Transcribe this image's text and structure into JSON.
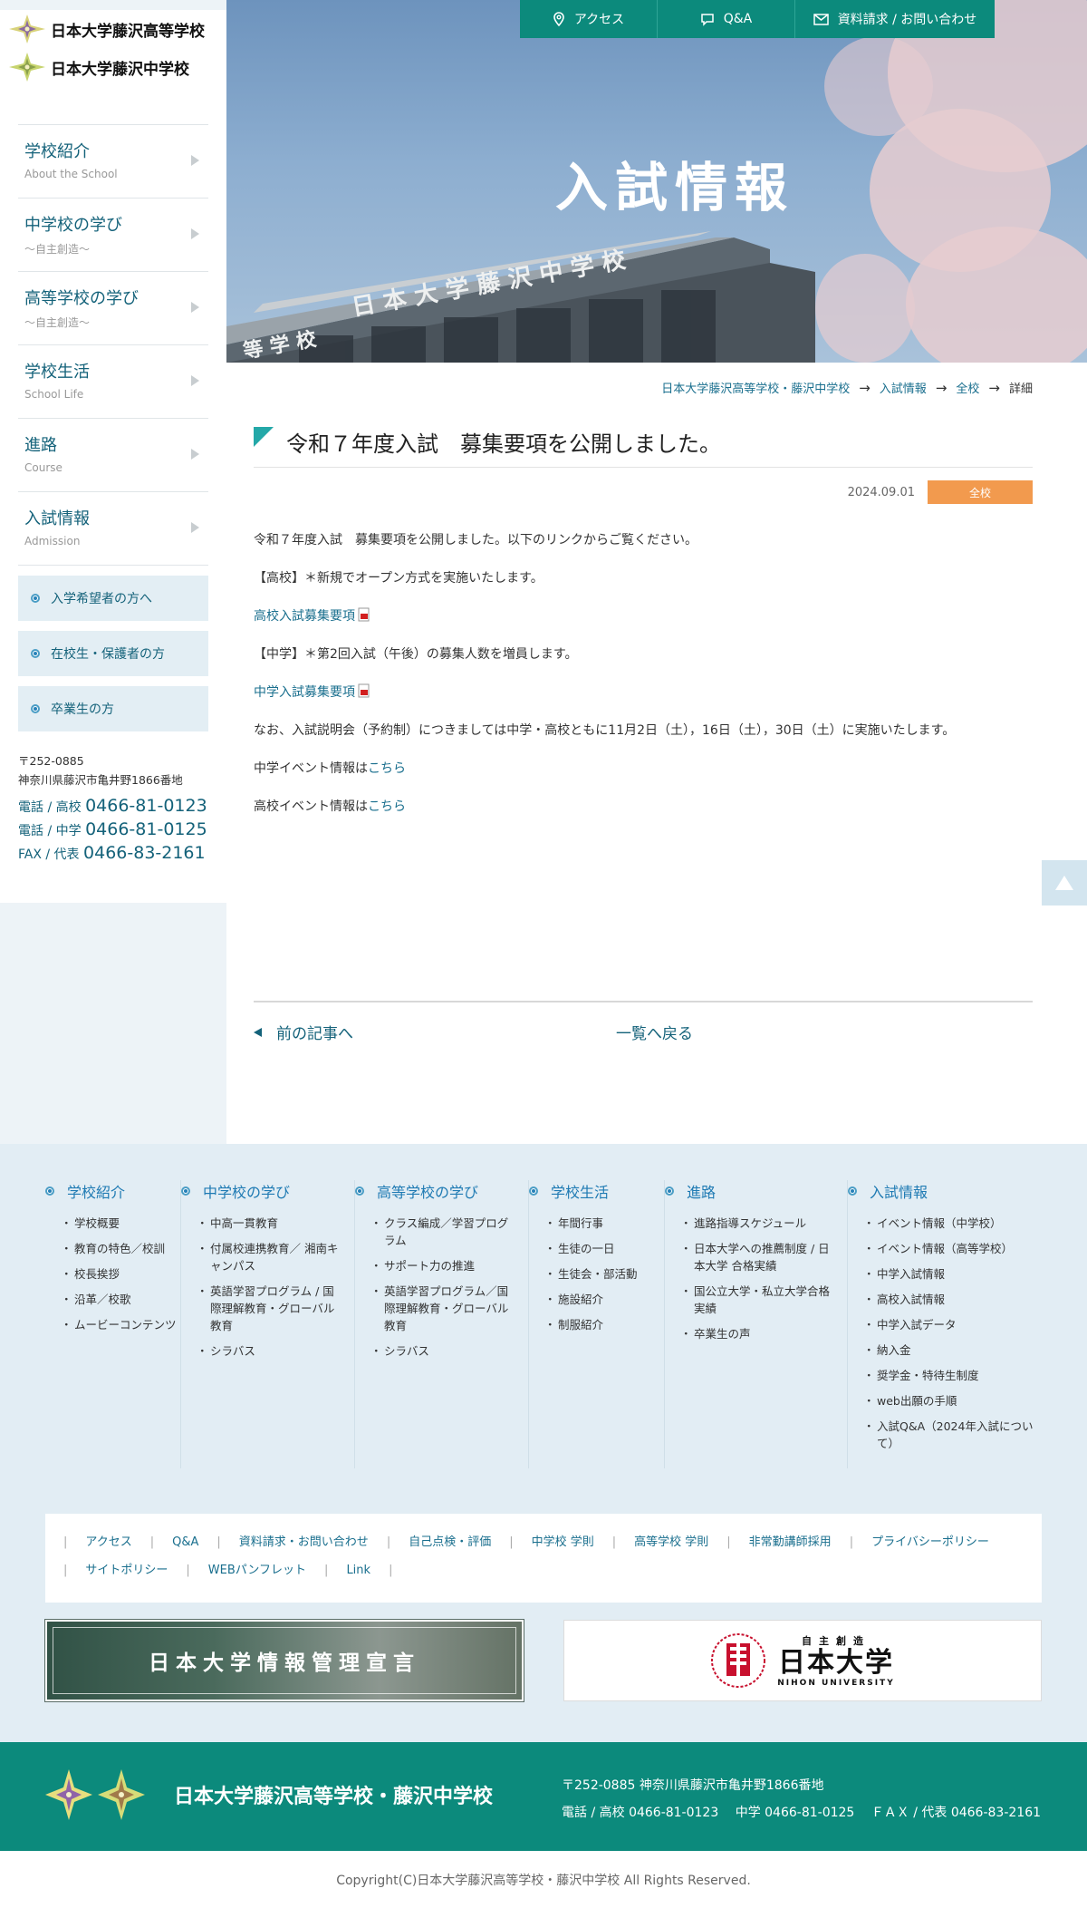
{
  "sidebar": {
    "logo_lines": [
      "日本大学藤沢高等学校",
      "日本大学藤沢中学校"
    ],
    "menu": [
      {
        "jp": "学校紹介",
        "en": "About the School"
      },
      {
        "jp": "中学校の学び",
        "en": "〜自主創造〜"
      },
      {
        "jp": "高等学校の学び",
        "en": "〜自主創造〜"
      },
      {
        "jp": "学校生活",
        "en": "School Life"
      },
      {
        "jp": "進路",
        "en": "Course"
      },
      {
        "jp": "入試情報",
        "en": "Admission"
      }
    ],
    "sub_buttons": [
      "入学希望者の方へ",
      "在校生・保護者の方",
      "卒業生の方"
    ],
    "postal": "〒252-0885",
    "address": "神奈川県藤沢市亀井野1866番地",
    "tel_high_label": "電話 / 高校",
    "tel_high": "0466-81-0123",
    "tel_middle_label": "電話 / 中学",
    "tel_middle": "0466-81-0125",
    "fax_label": "FAX / 代表",
    "fax": "0466-83-2161"
  },
  "topnav": {
    "access": "アクセス",
    "qa": "Q&A",
    "contact": "資料請求 / お問い合わせ"
  },
  "hero": {
    "title": "入試情報"
  },
  "breadcrumb": [
    "日本大学藤沢高等学校・藤沢中学校",
    "入試情報",
    "全校",
    "詳細"
  ],
  "article": {
    "title": "令和７年度入試　募集要項を公開しました。",
    "date": "2024.09.01",
    "category": "全校",
    "p1": "令和７年度入試　募集要項を公開しました。以下のリンクからご覧ください。",
    "p2": "【高校】＊新規でオープン方式を実施いたします。",
    "link_high": "高校入試募集要項",
    "p3": "【中学】＊第2回入試（午後）の募集人数を増員します。",
    "link_middle": "中学入試募集要項",
    "p4": "なお、入試説明会（予約制）につきましては中学・高校ともに11月2日（土），16日（土），30日（土）に実施いたします。",
    "p5_prefix": "中学イベント情報は",
    "p6_prefix": "高校イベント情報は",
    "here": "こちら"
  },
  "pager": {
    "prev": "前の記事へ",
    "back": "一覧へ戻る"
  },
  "footer_cols": [
    {
      "title": "学校紹介",
      "items": [
        "学校概要",
        "教育の特色／校訓",
        "校長挨拶",
        "沿革／校歌",
        "ムービーコンテンツ"
      ]
    },
    {
      "title": "中学校の学び",
      "items": [
        "中高一貫教育",
        "付属校連携教育／ 湘南キャンパス",
        "英語学習プログラム / 国際理解教育・グローバル教育",
        "シラバス"
      ]
    },
    {
      "title": "高等学校の学び",
      "items": [
        "クラス編成／学習プログラム",
        "サポート力の推進",
        "英語学習プログラム／国際理解教育・グローバル教育",
        "シラバス"
      ]
    },
    {
      "title": "学校生活",
      "items": [
        "年間行事",
        "生徒の一日",
        "生徒会・部活動",
        "施設紹介",
        "制服紹介"
      ]
    },
    {
      "title": "進路",
      "items": [
        "進路指導スケジュール",
        "日本大学への推薦制度 / 日本大学 合格実績",
        "国公立大学・私立大学合格実績",
        "卒業生の声"
      ]
    },
    {
      "title": "入試情報",
      "items": [
        "イベント情報（中学校）",
        "イベント情報（高等学校）",
        "中学入試情報",
        "高校入試情報",
        "中学入試データ",
        "納入金",
        "奨学金・特待生制度",
        "web出願の手順",
        "入試Q&A（2024年入試について）"
      ]
    }
  ],
  "footer_links_row1": [
    "アクセス",
    "Q&A",
    "資料請求・お問い合わせ",
    "自己点検・評価",
    "中学校 学則",
    "高等学校 学則",
    "非常勤講師採用",
    "プライバシーポリシー"
  ],
  "footer_links_row2": [
    "サイトポリシー",
    "WEBパンフレット",
    "Link"
  ],
  "banners": {
    "left": "日本大学情報管理宣言",
    "right_sub": "自主創造",
    "right_main": "日本大学",
    "right_en": "NIHON UNIVERSITY"
  },
  "bottom": {
    "school_name": "日本大学藤沢高等学校・藤沢中学校",
    "address": "〒252-0885 神奈川県藤沢市亀井野1866番地",
    "phones": "電話 / 高校 0466-81-0123　 中学 0466-81-0125　 ＦＡＸ / 代表 0466-83-2161"
  },
  "copyright": "Copyright(C)日本大学藤沢高等学校・藤沢中学校 All Rights Reserved.",
  "colors": {
    "brand_green": "#0c8a7c",
    "link_blue": "#1a6f8e",
    "badge_orange": "#f29a4e"
  }
}
